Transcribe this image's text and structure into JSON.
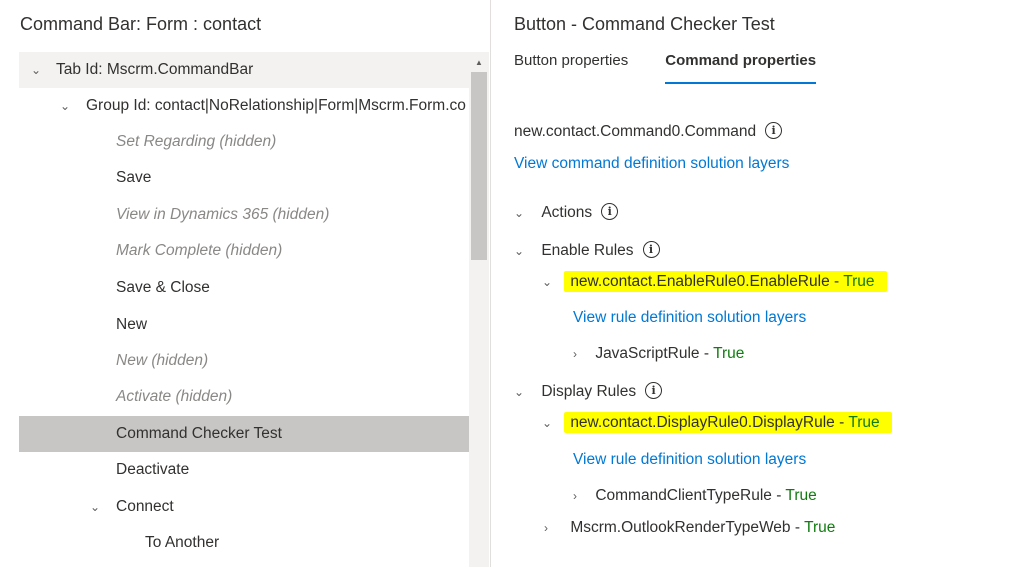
{
  "left_panel": {
    "title": "Command Bar: Form : contact",
    "tree": [
      {
        "label": "Tab Id: Mscrm.CommandBar",
        "kind": "tab"
      },
      {
        "label": "Group Id: contact|NoRelationship|Form|Mscrm.Form.co",
        "kind": "group"
      },
      {
        "label": "Set Regarding (hidden)",
        "kind": "command",
        "hidden": true
      },
      {
        "label": "Save",
        "kind": "command",
        "hidden": false
      },
      {
        "label": "View in Dynamics 365 (hidden)",
        "kind": "command",
        "hidden": true
      },
      {
        "label": "Mark Complete (hidden)",
        "kind": "command",
        "hidden": true
      },
      {
        "label": "Save & Close",
        "kind": "command",
        "hidden": false
      },
      {
        "label": "New",
        "kind": "command",
        "hidden": false
      },
      {
        "label": "New (hidden)",
        "kind": "command",
        "hidden": true
      },
      {
        "label": "Activate (hidden)",
        "kind": "command",
        "hidden": true
      },
      {
        "label": "Command Checker Test",
        "kind": "command",
        "hidden": false,
        "selected": true
      },
      {
        "label": "Deactivate",
        "kind": "command",
        "hidden": false
      },
      {
        "label": "Connect",
        "kind": "flyout",
        "hidden": false
      },
      {
        "label": "To Another",
        "kind": "subcommand",
        "hidden": false
      }
    ]
  },
  "right_panel": {
    "title": "Button - Command Checker Test",
    "tabs": [
      {
        "label": "Button properties",
        "active": false
      },
      {
        "label": "Command properties",
        "active": true
      }
    ],
    "command_name": "new.contact.Command0.Command",
    "command_link": "View command definition solution layers",
    "actions_label": "Actions",
    "enable_rules": {
      "label": "Enable Rules",
      "rule_name": "new.contact.EnableRule0.EnableRule",
      "rule_result": "True",
      "link": "View rule definition solution layers",
      "children": [
        {
          "name": "JavaScriptRule",
          "result": "True"
        }
      ]
    },
    "display_rules": {
      "label": "Display Rules",
      "rule_name": "new.contact.DisplayRule0.DisplayRule",
      "rule_result": "True",
      "link": "View rule definition solution layers",
      "children": [
        {
          "name": "CommandClientTypeRule",
          "result": "True"
        }
      ],
      "extra_rule": {
        "name": "Mscrm.OutlookRenderTypeWeb",
        "result": "True"
      }
    },
    "separator": " - "
  },
  "colors": {
    "link": "#0078d4",
    "true": "#107c10",
    "highlight": "#ffff00",
    "selected_row": "#c8c6c4",
    "hidden_text": "#8a8886"
  },
  "icons": {
    "expanded": "chevron-down-icon",
    "collapsed": "chevron-right-icon",
    "info": "info-icon",
    "scroll_up": "scroll-up-arrow-icon"
  }
}
